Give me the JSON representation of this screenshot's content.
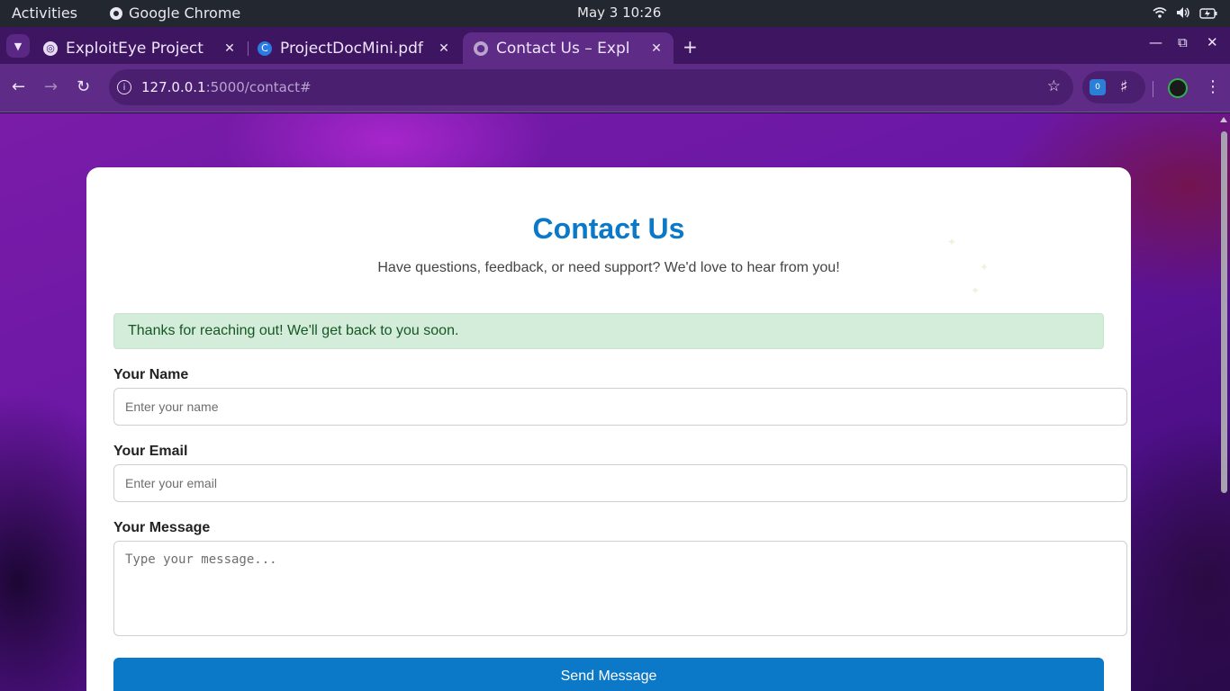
{
  "system_bar": {
    "activities": "Activities",
    "app_name": "Google Chrome",
    "clock": "May  3  10:26"
  },
  "browser": {
    "tabs": [
      {
        "title": "ExploitEye Project",
        "active": false
      },
      {
        "title": "ProjectDocMini.pdf",
        "active": false
      },
      {
        "title": "Contact Us – Expl",
        "active": true
      }
    ],
    "url_host": "127.0.0.1",
    "url_path": ":5000/contact#",
    "extension_badge": "0"
  },
  "page": {
    "heading": "Contact Us",
    "subtitle": "Have questions, feedback, or need support? We'd love to hear from you!",
    "success_message": "Thanks for reaching out! We'll get back to you soon.",
    "name_label": "Your Name",
    "name_placeholder": "Enter your name",
    "email_label": "Your Email",
    "email_placeholder": "Enter your email",
    "message_label": "Your Message",
    "message_placeholder": "Type your message...",
    "submit_label": "Send Message"
  },
  "colors": {
    "accent": "#0b78c8",
    "success_bg": "#d4edda",
    "success_text": "#155724",
    "browser_frame": "#5e2c86"
  }
}
